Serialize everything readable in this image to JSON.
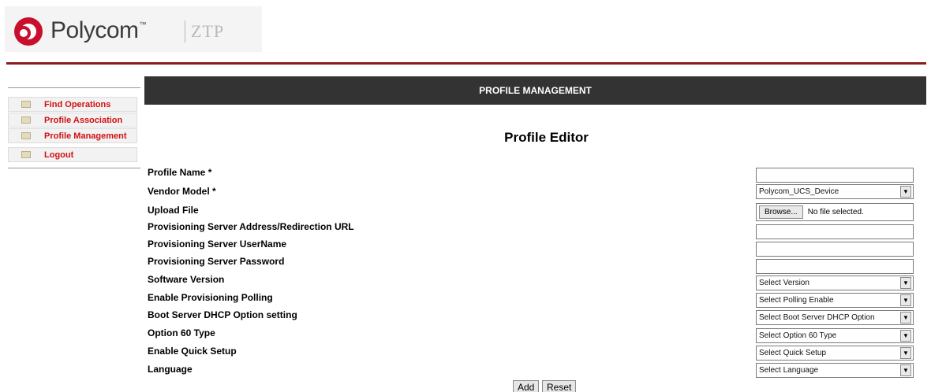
{
  "header": {
    "brand": "Polycom",
    "brand_tm": "™",
    "product": "ZTP"
  },
  "sidebar": {
    "items": [
      {
        "label": "Find Operations"
      },
      {
        "label": "Profile Association"
      },
      {
        "label": "Profile Management"
      },
      {
        "label": "Logout"
      }
    ]
  },
  "main": {
    "banner": "PROFILE MANAGEMENT",
    "title": "Profile Editor"
  },
  "form": {
    "profile_name": {
      "label": "Profile Name *",
      "value": ""
    },
    "vendor_model": {
      "label": "Vendor Model *",
      "value": "Polycom_UCS_Device"
    },
    "upload_file": {
      "label": "Upload File",
      "button": "Browse...",
      "status": "No file selected."
    },
    "prov_server_address": {
      "label": "Provisioning Server Address/Redirection URL",
      "value": ""
    },
    "prov_server_username": {
      "label": "Provisioning Server UserName",
      "value": ""
    },
    "prov_server_password": {
      "label": "Provisioning Server Password",
      "value": ""
    },
    "software_version": {
      "label": "Software Version",
      "value": "Select Version"
    },
    "enable_polling": {
      "label": "Enable Provisioning Polling",
      "value": "Select Polling Enable"
    },
    "boot_server_dhcp": {
      "label": "Boot Server DHCP Option setting",
      "value": "Select Boot Server DHCP Option"
    },
    "option60_type": {
      "label": "Option 60 Type",
      "value": "Select Option 60 Type"
    },
    "quick_setup": {
      "label": "Enable Quick Setup",
      "value": "Select Quick Setup"
    },
    "language": {
      "label": "Language",
      "value": "Select Language"
    }
  },
  "actions": {
    "add_label": "Add",
    "reset_label": "Reset"
  },
  "icons": {
    "dropdown_arrow": "▼"
  },
  "colors": {
    "accent_rule": "#8a1c1c",
    "nav_text": "#d11010",
    "banner_bg": "#333333"
  }
}
